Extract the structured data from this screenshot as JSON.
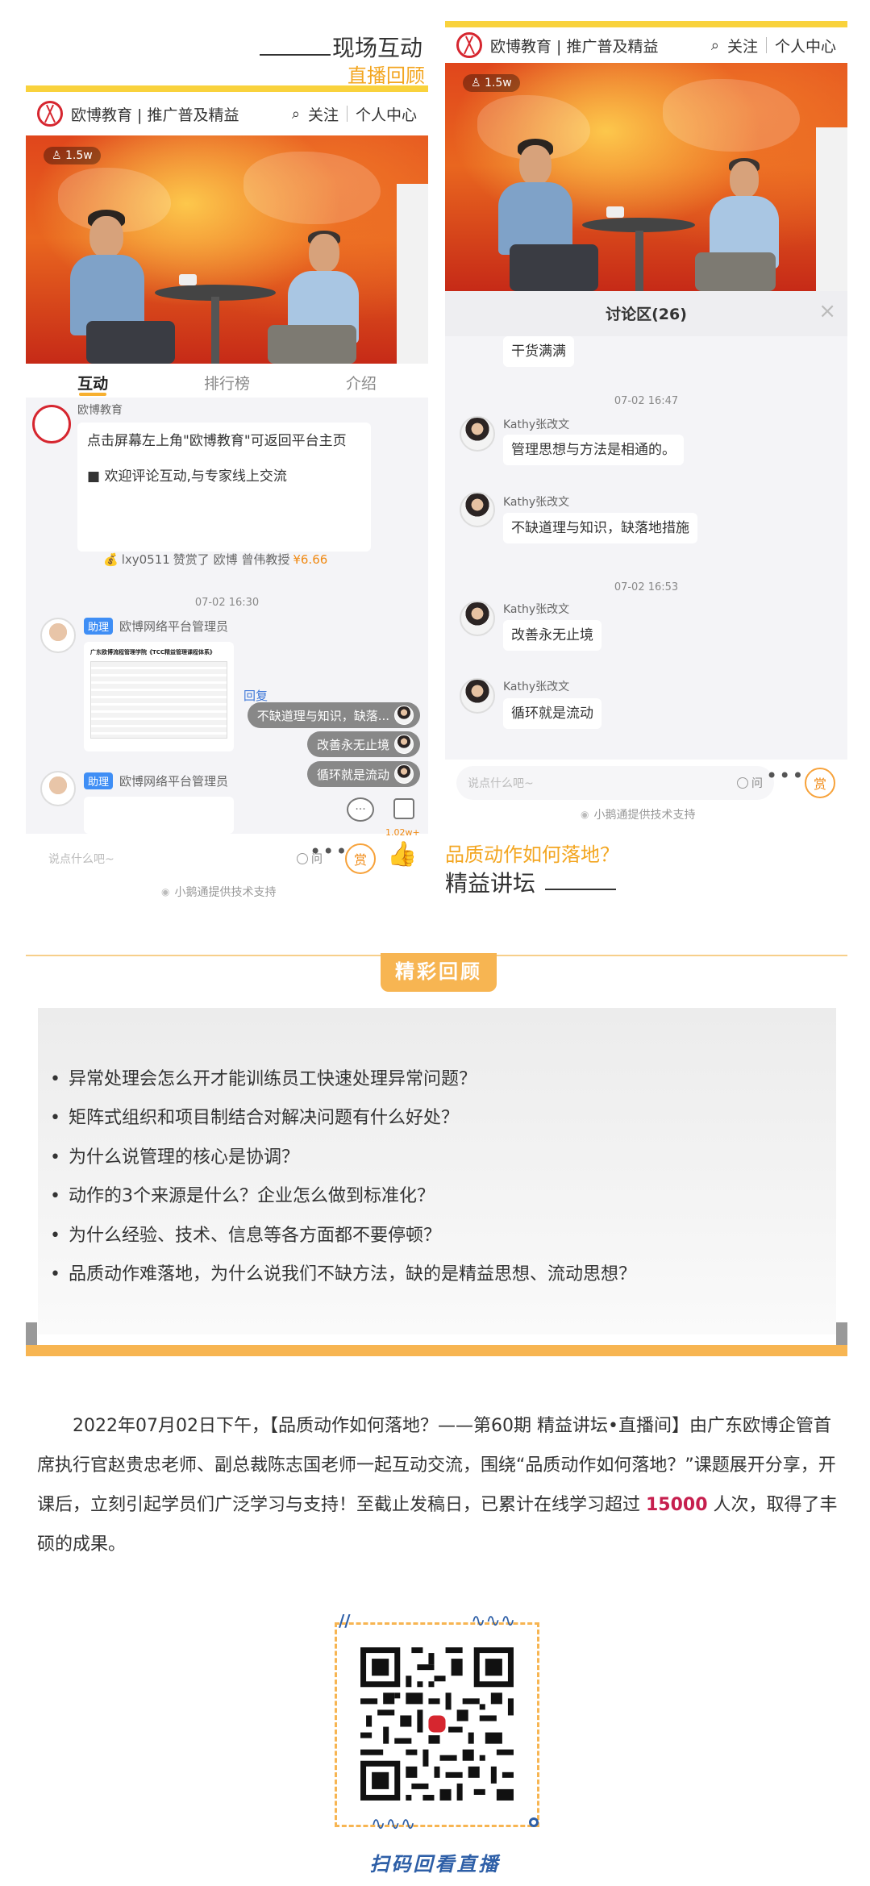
{
  "sections": {
    "live_interaction": {
      "title": "现场互动",
      "subtitle": "直播回顾"
    },
    "forum": {
      "question": "品质动作如何落地？",
      "name": "精益讲坛"
    },
    "highlights_title": "精彩回顾",
    "qr_caption": "扫码回看直播"
  },
  "app": {
    "brand": "欧博教育 | 推广普及精益",
    "follow": "关注",
    "profile": "个人中心",
    "viewers": "1.5w",
    "support": "小鹅通提供技术支持",
    "input_placeholder": "说点什么吧~",
    "ask_label": "问",
    "reward_label": "赏",
    "likes": "1.02w+"
  },
  "left_phone": {
    "tabs": [
      "互动",
      "排行榜",
      "介绍"
    ],
    "sender": "欧博教育",
    "notice_line1": "点击屏幕左上角\"欧博教育\"可返回平台主页",
    "notice_line2": "■ 欢迎评论互动,与专家线上交流",
    "reward_user": "lxy0511",
    "reward_mid": "赞赏了 欧博 曾伟教授",
    "reward_amount": "¥6.66",
    "time": "07-02 16:30",
    "assistant_badge": "助理",
    "assistant_name": "欧博网络平台管理员",
    "doc_title": "广东欧博流程管理学院《TCC精益管理课程体系》",
    "reply_label": "回复",
    "pills": [
      "不缺道理与知识，缺落...",
      "改善永无止境",
      "循环就是流动"
    ]
  },
  "right_phone": {
    "discussion_title": "讨论区(26)",
    "close": "×",
    "first_msg": "干货满满",
    "messages": [
      {
        "time": "07-02 16:47",
        "name": "Kathy张改文",
        "text": "管理思想与方法是相通的。"
      },
      {
        "time": "",
        "name": "Kathy张改文",
        "text": "不缺道理与知识，缺落地措施"
      },
      {
        "time": "07-02 16:53",
        "name": "Kathy张改文",
        "text": "改善永无止境"
      },
      {
        "time": "",
        "name": "Kathy张改文",
        "text": "循环就是流动"
      }
    ]
  },
  "highlights": [
    "异常处理会怎么开才能训练员工快速处理异常问题？",
    "矩阵式组织和项目制结合对解决问题有什么好处？",
    "为什么说管理的核心是协调？",
    "动作的3个来源是什么？企业怎么做到标准化？",
    "为什么经验、技术、信息等各方面都不要停顿？",
    "品质动作难落地，为什么说我们不缺方法，缺的是精益思想、流动思想？"
  ],
  "summary": {
    "before": "2022年07月02日下午，【品质动作如何落地？——第60期 精益讲坛•直播间】由广东欧博企管首席执行官赵贵忠老师、副总裁陈志国老师一起互动交流，围绕“品质动作如何落地？”课题展开分享，开课后，立刻引起学员们广泛学习与支持！至截止发稿日，已累计在线学习超过 ",
    "count": "15000",
    "after": " 人次，取得了丰硕的成果。"
  },
  "colors": {
    "accent_orange": "#f3a621",
    "yellow_bar": "#f9d23c",
    "highlight_red": "#c61f4e",
    "badge_blue": "#3f8ef5"
  }
}
